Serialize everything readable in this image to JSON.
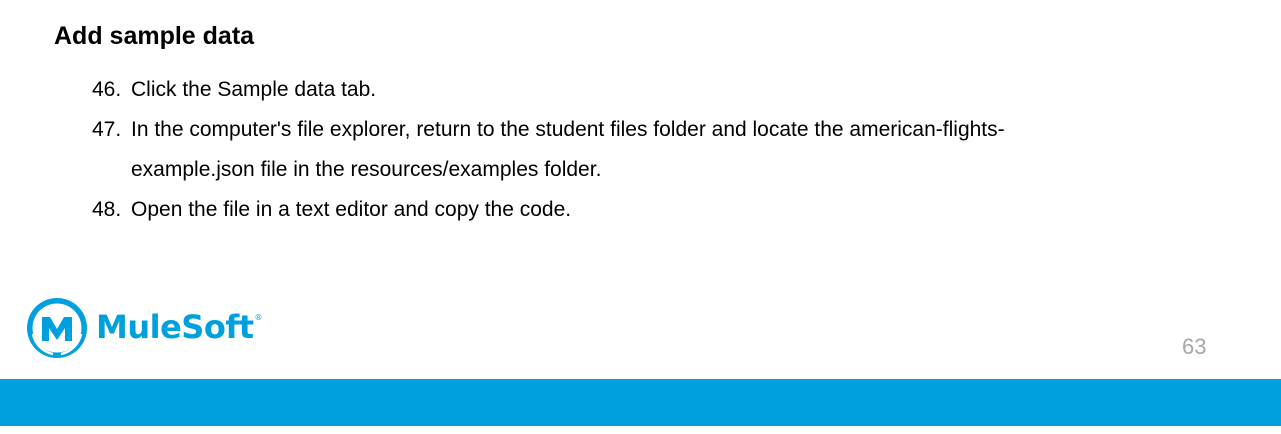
{
  "heading": "Add sample data",
  "steps": [
    {
      "number": "46.",
      "lines": [
        "Click the Sample data tab."
      ]
    },
    {
      "number": "47.",
      "lines": [
        "In the computer's file explorer, return to the student files folder and locate the american-flights-",
        "example.json file in the resources/examples folder."
      ]
    },
    {
      "number": "48.",
      "lines": [
        "Open the file in a text editor and copy the code."
      ]
    }
  ],
  "logo": {
    "name": "MuleSoft",
    "registered_mark": "®",
    "icon": "mulesoft-m-logo-icon"
  },
  "page_number": "63",
  "colors": {
    "brand_blue": "#00A0DF",
    "page_number_gray": "#a6a6a6"
  }
}
